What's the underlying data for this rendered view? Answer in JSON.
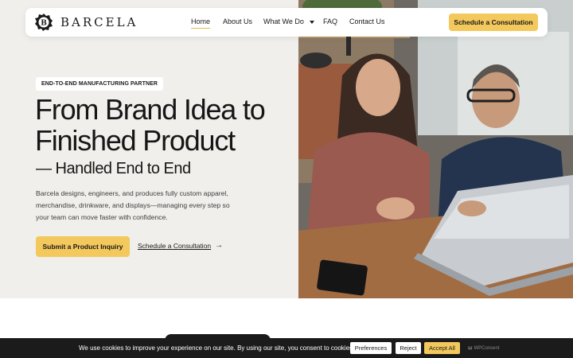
{
  "brand": {
    "name": "BARCELA",
    "logo_letter": "B"
  },
  "nav": {
    "items": [
      {
        "label": "Home",
        "active": true
      },
      {
        "label": "About Us"
      },
      {
        "label": "What We Do",
        "has_dropdown": true
      },
      {
        "label": "FAQ"
      },
      {
        "label": "Contact Us"
      }
    ],
    "cta": "Schedule a Consultation"
  },
  "hero": {
    "eyebrow": "END-TO-END MANUFACTURING PARTNER",
    "title": "From Brand Idea to Finished Product",
    "subtitle": "— Handled End to End",
    "description": "Barcela designs, engineers, and produces fully custom apparel, merchandise, drinkware, and displays—managing every step so your team can move faster with confidence.",
    "primary_button": "Submit a Product Inquiry",
    "secondary_link": "Schedule a Consultation"
  },
  "cookie": {
    "message": "We use cookies to improve your experience on our site. By using our site, you consent to cookies.",
    "preferences": "Preferences",
    "reject": "Reject",
    "accept": "Accept All",
    "powered_by": "WPConsent"
  },
  "colors": {
    "accent": "#f3c85c",
    "hero_bg": "#f1efec",
    "text": "#161616",
    "cookie_bar": "#1b1b1b"
  }
}
